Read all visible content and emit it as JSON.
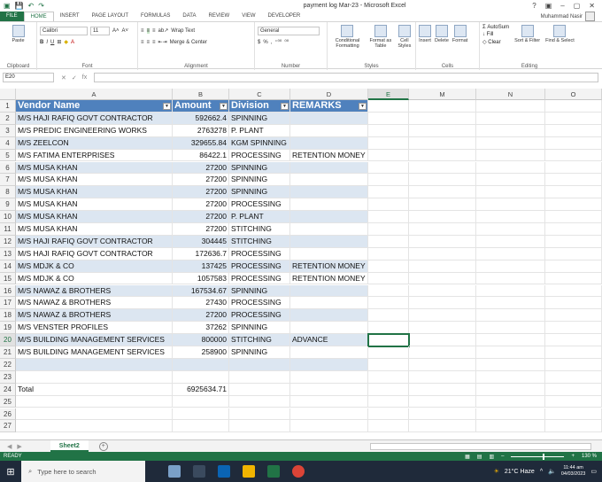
{
  "window": {
    "title": "payment log Mar-23 - Microsoft Excel",
    "user": "Muhammad Nasir",
    "controls": [
      "?",
      "▣",
      "–",
      "▢",
      "✕"
    ]
  },
  "tabs": [
    "FILE",
    "HOME",
    "INSERT",
    "PAGE LAYOUT",
    "FORMULAS",
    "DATA",
    "REVIEW",
    "VIEW",
    "DEVELOPER"
  ],
  "ribbon": {
    "clipboard": {
      "paste": "Paste",
      "label": "Clipboard"
    },
    "font": {
      "name": "Calibri",
      "size": "11",
      "bold": "B",
      "italic": "I",
      "underline": "U",
      "grow": "A˄",
      "shrink": "A˅",
      "label": "Font"
    },
    "alignment": {
      "wrap": "Wrap Text",
      "merge": "Merge & Center",
      "label": "Alignment"
    },
    "number": {
      "format": "General",
      "currency": "$",
      "percent": "%",
      "comma": ",",
      "inc": "⁺⁰⁰",
      "dec": "⁰⁰",
      "label": "Number"
    },
    "styles": {
      "conditional": "Conditional Formatting",
      "format_table": "Format as Table",
      "cell_styles": "Cell Styles",
      "label": "Styles"
    },
    "cells": {
      "insert": "Insert",
      "delete": "Delete",
      "format": "Format",
      "label": "Cells"
    },
    "editing": {
      "autosum": "AutoSum",
      "fill": "Fill",
      "clear": "Clear",
      "sort": "Sort & Filter",
      "find": "Find & Select",
      "label": "Editing"
    }
  },
  "formula_bar": {
    "name_box": "E20",
    "fx": "fx",
    "cancel": "✕",
    "enter": "✓",
    "value": ""
  },
  "columns": [
    "A",
    "B",
    "C",
    "D",
    "E",
    "M",
    "N",
    "O"
  ],
  "table_header": {
    "vendor": "Vendor Name",
    "amount": "Amount",
    "division": "Division",
    "remarks": "REMARKS"
  },
  "rows": [
    {
      "n": "2",
      "vendor": "M/S HAJI RAFIQ GOVT CONTRACTOR",
      "amount": "592662.4",
      "division": "SPINNING",
      "remarks": ""
    },
    {
      "n": "3",
      "vendor": "M/S PREDIC ENGINEERING WORKS",
      "amount": "2763278",
      "division": "P. PLANT",
      "remarks": ""
    },
    {
      "n": "4",
      "vendor": "M/S ZEELCON",
      "amount": "329655.84",
      "division": "KGM SPINNING",
      "remarks": ""
    },
    {
      "n": "5",
      "vendor": "M/S FATIMA ENTERPRISES",
      "amount": "86422.1",
      "division": "PROCESSING",
      "remarks": "RETENTION MONEY"
    },
    {
      "n": "6",
      "vendor": "M/S MUSA KHAN",
      "amount": "27200",
      "division": "SPINNING",
      "remarks": ""
    },
    {
      "n": "7",
      "vendor": "M/S MUSA KHAN",
      "amount": "27200",
      "division": "SPINNING",
      "remarks": ""
    },
    {
      "n": "8",
      "vendor": "M/S MUSA KHAN",
      "amount": "27200",
      "division": "SPINNING",
      "remarks": ""
    },
    {
      "n": "9",
      "vendor": "M/S MUSA KHAN",
      "amount": "27200",
      "division": "PROCESSING",
      "remarks": ""
    },
    {
      "n": "10",
      "vendor": "M/S MUSA KHAN",
      "amount": "27200",
      "division": "P. PLANT",
      "remarks": ""
    },
    {
      "n": "11",
      "vendor": "M/S MUSA KHAN",
      "amount": "27200",
      "division": "STITCHING",
      "remarks": ""
    },
    {
      "n": "12",
      "vendor": "M/S HAJI RAFIQ GOVT CONTRACTOR",
      "amount": "304445",
      "division": "STITCHING",
      "remarks": ""
    },
    {
      "n": "13",
      "vendor": "M/S HAJI RAFIQ GOVT CONTRACTOR",
      "amount": "172636.7",
      "division": "PROCESSING",
      "remarks": ""
    },
    {
      "n": "14",
      "vendor": "M/S MDJK & CO",
      "amount": "137425",
      "division": "PROCESSING",
      "remarks": "RETENTION MONEY"
    },
    {
      "n": "15",
      "vendor": "M/S MDJK & CO",
      "amount": "1057583",
      "division": "PROCESSING",
      "remarks": "RETENTION MONEY"
    },
    {
      "n": "16",
      "vendor": "M/S NAWAZ & BROTHERS",
      "amount": "167534.67",
      "division": "SPINNING",
      "remarks": ""
    },
    {
      "n": "17",
      "vendor": "M/S NAWAZ & BROTHERS",
      "amount": "27430",
      "division": "PROCESSING",
      "remarks": ""
    },
    {
      "n": "18",
      "vendor": "M/S NAWAZ & BROTHERS",
      "amount": "27200",
      "division": "PROCESSING",
      "remarks": ""
    },
    {
      "n": "19",
      "vendor": "M/S VENSTER PROFILES",
      "amount": "37262",
      "division": "SPINNING",
      "remarks": ""
    },
    {
      "n": "20",
      "vendor": "M/S BUILDING MANAGEMENT SERVICES",
      "amount": "800000",
      "division": "STITCHING",
      "remarks": "ADVANCE"
    },
    {
      "n": "21",
      "vendor": "M/S BUILDING MANAGEMENT SERVICES",
      "amount": "258900",
      "division": "SPINNING",
      "remarks": ""
    },
    {
      "n": "22",
      "vendor": "",
      "amount": "",
      "division": "",
      "remarks": ""
    },
    {
      "n": "23",
      "vendor": "",
      "amount": "",
      "division": "",
      "remarks": ""
    },
    {
      "n": "24",
      "vendor": "Total",
      "amount": "6925634.71",
      "division": "",
      "remarks": ""
    },
    {
      "n": "25",
      "vendor": "",
      "amount": "",
      "division": "",
      "remarks": ""
    },
    {
      "n": "26",
      "vendor": "",
      "amount": "",
      "division": "",
      "remarks": ""
    },
    {
      "n": "27",
      "vendor": "",
      "amount": "",
      "division": "",
      "remarks": ""
    }
  ],
  "sheet": {
    "tab": "Sheet2",
    "add": "+"
  },
  "status": {
    "mode": "READY",
    "zoom": "130 %"
  },
  "taskbar": {
    "search_placeholder": "Type here to search",
    "weather": "21°C Haze",
    "time": "11:44 am",
    "date": "04/03/2023"
  }
}
